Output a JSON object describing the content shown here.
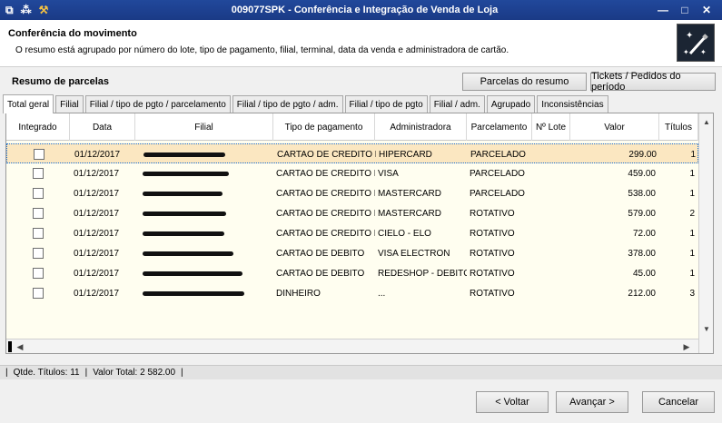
{
  "window": {
    "title": "009077SPK - Conferência e Integração de Venda de Loja",
    "controls": [
      "—",
      "□",
      "✕"
    ]
  },
  "header": {
    "title": "Conferência do movimento",
    "description": "O resumo está agrupado por número do lote, tipo de pagamento, filial, terminal, data da venda e administradora de cartão.",
    "logo_icon": "magic-wand-icon"
  },
  "summary": {
    "label": "Resumo de parcelas",
    "parcelas_button": "Parcelas do resumo",
    "tickets_button": "Tickets / Pedidos do período"
  },
  "tabs": [
    {
      "label": "Total geral",
      "active": true
    },
    {
      "label": "Filial"
    },
    {
      "label": "Filial / tipo de pgto / parcelamento"
    },
    {
      "label": "Filial / tipo de pgto / adm."
    },
    {
      "label": "Filial / tipo de pgto"
    },
    {
      "label": "Filial / adm."
    },
    {
      "label": "Agrupado"
    },
    {
      "label": "Inconsistências"
    }
  ],
  "grid": {
    "columns": [
      "Integrado",
      "Data",
      "Filial",
      "Tipo de pagamento",
      "Administradora",
      "Parcelamento",
      "Nº Lote",
      "Valor",
      "Títulos"
    ],
    "rows": [
      {
        "date": "01/12/2017",
        "tipo": "CARTAO DE CREDITO F",
        "adm": "HIPERCARD",
        "parcel": "PARCELADO",
        "lote": "",
        "valor": "299.00",
        "titulos": "1"
      },
      {
        "date": "01/12/2017",
        "tipo": "CARTAO DE CREDITO F",
        "adm": "VISA",
        "parcel": "PARCELADO",
        "lote": "",
        "valor": "459.00",
        "titulos": "1"
      },
      {
        "date": "01/12/2017",
        "tipo": "CARTAO DE CREDITO F",
        "adm": "MASTERCARD",
        "parcel": "PARCELADO",
        "lote": "",
        "valor": "538.00",
        "titulos": "1"
      },
      {
        "date": "01/12/2017",
        "tipo": "CARTAO DE CREDITO F",
        "adm": "MASTERCARD",
        "parcel": "ROTATIVO",
        "lote": "",
        "valor": "579.00",
        "titulos": "2"
      },
      {
        "date": "01/12/2017",
        "tipo": "CARTAO DE CREDITO F",
        "adm": "CIELO - ELO",
        "parcel": "ROTATIVO",
        "lote": "",
        "valor": "72.00",
        "titulos": "1"
      },
      {
        "date": "01/12/2017",
        "tipo": "CARTAO DE DEBITO",
        "adm": "VISA ELECTRON",
        "parcel": "ROTATIVO",
        "lote": "",
        "valor": "378.00",
        "titulos": "1"
      },
      {
        "date": "01/12/2017",
        "tipo": "CARTAO DE DEBITO",
        "adm": "REDESHOP - DEBITC",
        "parcel": "ROTATIVO",
        "lote": "",
        "valor": "45.00",
        "titulos": "1"
      },
      {
        "date": "01/12/2017",
        "tipo": "DINHEIRO",
        "adm": "...",
        "parcel": "ROTATIVO",
        "lote": "",
        "valor": "212.00",
        "titulos": "3"
      }
    ]
  },
  "status": {
    "sep": "|",
    "qtde": "Qtde. Títulos: 11",
    "total": "Valor Total: 2 582.00"
  },
  "buttons": {
    "voltar": "< Voltar",
    "avancar": "Avançar >",
    "cancelar": "Cancelar"
  }
}
